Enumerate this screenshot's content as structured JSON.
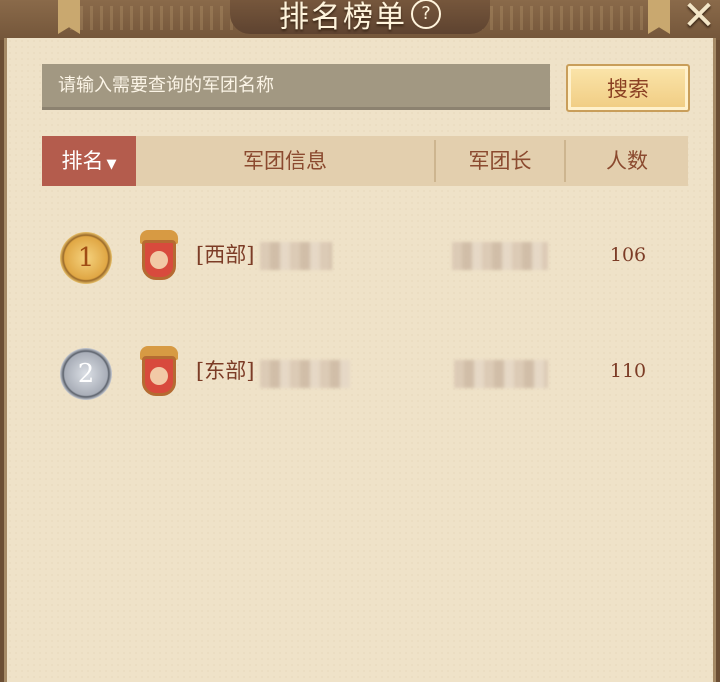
{
  "window": {
    "title": "排名榜单",
    "help_icon": "?",
    "close_icon": "✕"
  },
  "search": {
    "placeholder": "请输入需要查询的军团名称",
    "button_label": "搜索"
  },
  "table": {
    "columns": {
      "rank": "排名",
      "info": "军团信息",
      "leader": "军团长",
      "members": "人数"
    },
    "rows": [
      {
        "rank": "1",
        "name": "[西部]",
        "members": "106"
      },
      {
        "rank": "2",
        "name": "[东部]",
        "members": "110"
      }
    ]
  },
  "colors": {
    "panel": "#efe2c8",
    "accent_red": "#b45c4d",
    "header_brown": "#74563a",
    "text_brown": "#7c3c26"
  }
}
